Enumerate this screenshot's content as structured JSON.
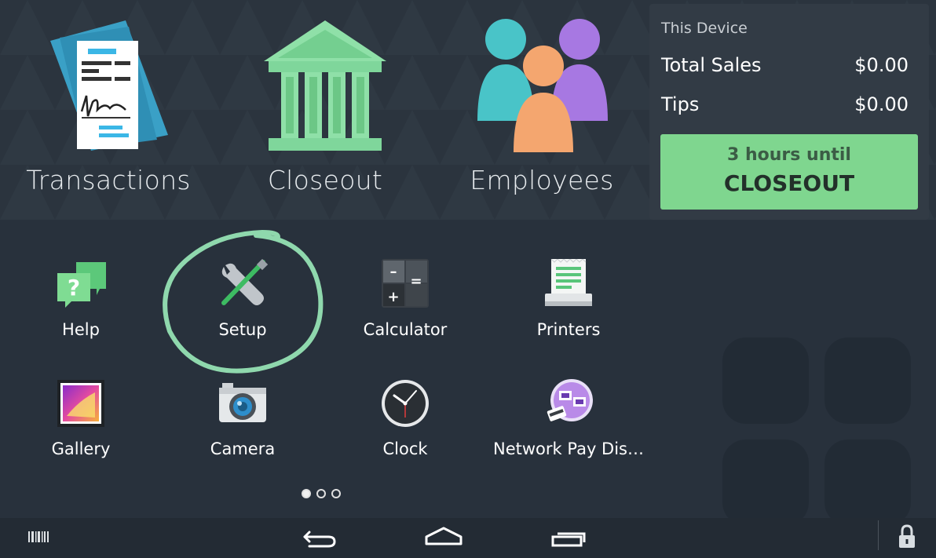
{
  "tiles": [
    {
      "label": "Transactions",
      "icon": "transactions-icon"
    },
    {
      "label": "Closeout",
      "icon": "bank-icon"
    },
    {
      "label": "Employees",
      "icon": "employees-icon"
    }
  ],
  "device_panel": {
    "title": "This Device",
    "rows": [
      {
        "label": "Total Sales",
        "value": "$0.00"
      },
      {
        "label": "Tips",
        "value": "$0.00"
      }
    ],
    "closeout_button": {
      "line1": "3 hours until",
      "line2": "CLOSEOUT"
    }
  },
  "apps": [
    {
      "label": "Help",
      "icon": "help-icon"
    },
    {
      "label": "Setup",
      "icon": "setup-tools-icon"
    },
    {
      "label": "Calculator",
      "icon": "calculator-icon"
    },
    {
      "label": "Printers",
      "icon": "printer-icon"
    },
    {
      "label": "Gallery",
      "icon": "gallery-icon"
    },
    {
      "label": "Camera",
      "icon": "camera-icon"
    },
    {
      "label": "Clock",
      "icon": "clock-icon"
    },
    {
      "label": "Network Pay Dis…",
      "icon": "network-pay-display-icon"
    }
  ],
  "pager": {
    "pages": 3,
    "current": 1
  },
  "navbar": {
    "icons": [
      "barcode-icon",
      "back-icon",
      "home-icon",
      "recent-apps-icon",
      "lock-icon"
    ]
  },
  "colors": {
    "accent_green": "#7fd68f",
    "background": "#28313c",
    "highlight": "#8fd8ad"
  }
}
